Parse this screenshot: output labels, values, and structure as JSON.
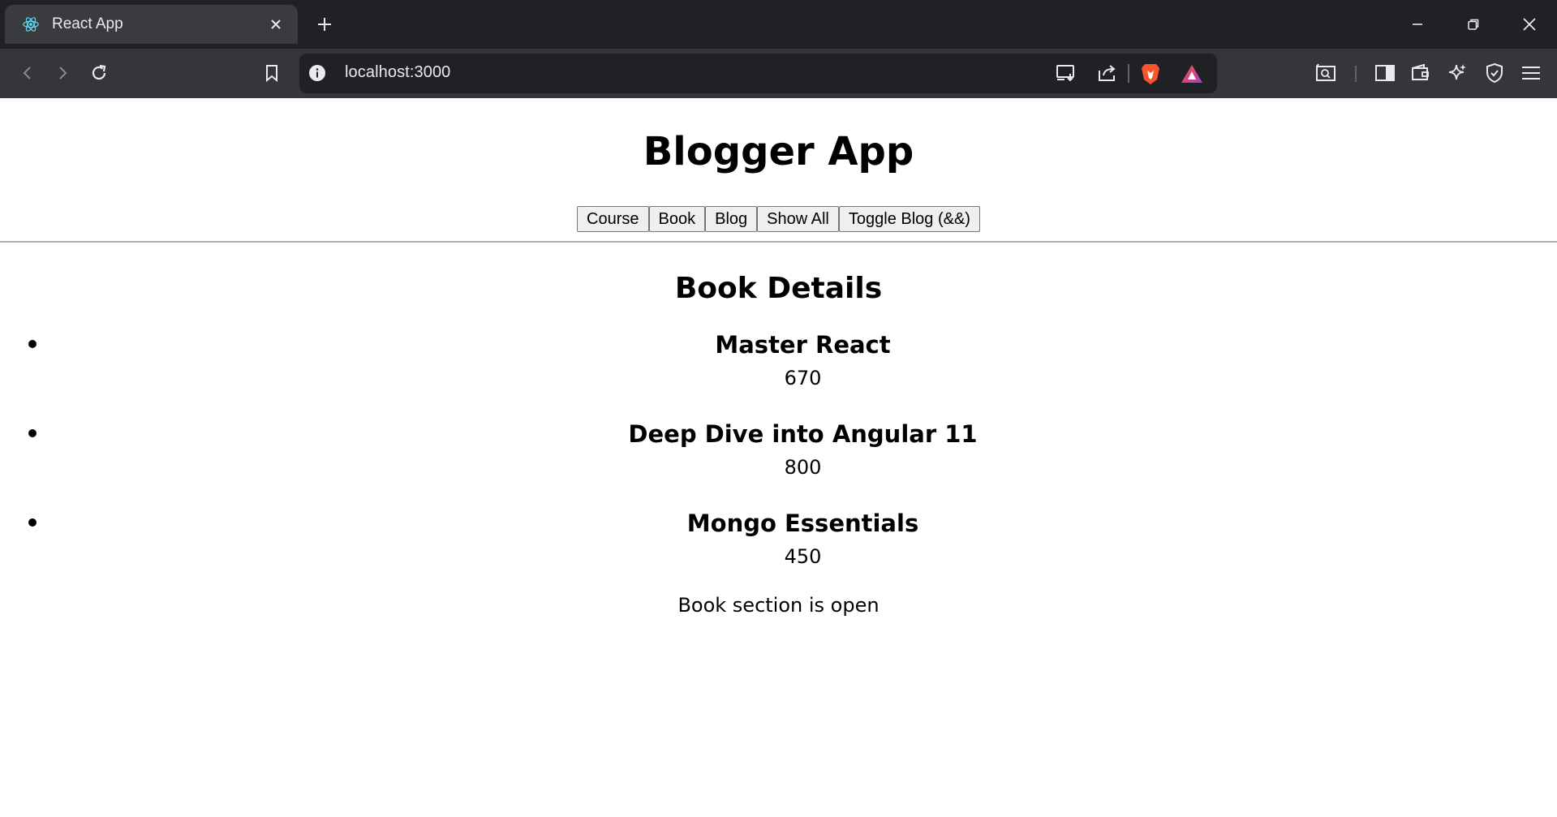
{
  "browser": {
    "tab": {
      "title": "React App",
      "icon": "react-logo-icon"
    },
    "address_bar": {
      "url": "localhost:3000"
    },
    "accent_colors": {
      "brave": "#fb542b",
      "rewards": "#a83cc9"
    }
  },
  "app": {
    "title": "Blogger App",
    "buttons": [
      {
        "label": "Course"
      },
      {
        "label": "Book"
      },
      {
        "label": "Blog"
      },
      {
        "label": "Show All"
      },
      {
        "label": "Toggle Blog (&&)"
      }
    ],
    "section": {
      "title": "Book Details",
      "books": [
        {
          "name": "Master React",
          "price": "670"
        },
        {
          "name": "Deep Dive into Angular 11",
          "price": "800"
        },
        {
          "name": "Mongo Essentials",
          "price": "450"
        }
      ],
      "status": "Book section is open"
    }
  }
}
